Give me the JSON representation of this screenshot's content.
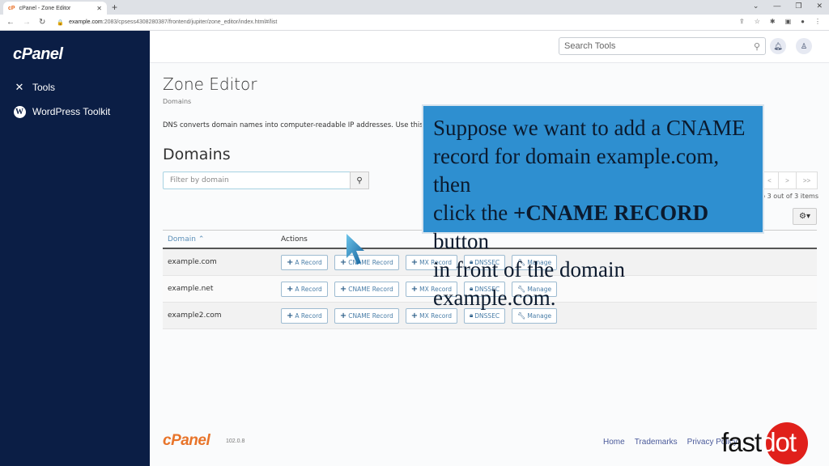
{
  "browser": {
    "tab_title": "cPanel - Zone Editor",
    "favicon": "cP",
    "url_host": "example.com",
    "url_path": ":2083/cpsess4308280387/frontend/jupiter/zone_editor/index.html#/list"
  },
  "sidebar": {
    "logo": "cPanel",
    "items": [
      {
        "label": "Tools",
        "icon": "tools-icon"
      },
      {
        "label": "WordPress Toolkit",
        "icon": "wordpress-icon"
      }
    ]
  },
  "header": {
    "search_placeholder": "Search Tools"
  },
  "page": {
    "title": "Zone Editor",
    "breadcrumb": "Domains",
    "description": "DNS converts domain names into computer-readable IP addresses. Use this",
    "section_title": "Domains",
    "filter_placeholder": "Filter by domain",
    "pager": [
      "<",
      ">",
      ">>"
    ],
    "items_info": "to 3 out of 3 items"
  },
  "table": {
    "headers": {
      "domain": "Domain",
      "actions": "Actions"
    },
    "action_labels": {
      "a_record": "A Record",
      "cname_record": "CNAME Record",
      "mx_record": "MX Record",
      "dnssec": "DNSSEC",
      "manage": "Manage"
    },
    "rows": [
      {
        "domain": "example.com"
      },
      {
        "domain": "example.net"
      },
      {
        "domain": "example2.com"
      }
    ]
  },
  "footer": {
    "logo": "cPanel",
    "version": "102.0.8",
    "links": [
      "Home",
      "Trademarks",
      "Privacy Policy"
    ]
  },
  "callout": {
    "line1": "Suppose we want to add a CNAME",
    "line2": "record for domain example.com, then",
    "line3_pre": "click the ",
    "line3_bold": "+CNAME RECORD",
    "line3_post": " button",
    "line4": "in front of the domain example.com."
  },
  "watermark": {
    "part1": "fast",
    "part2": "dot"
  }
}
